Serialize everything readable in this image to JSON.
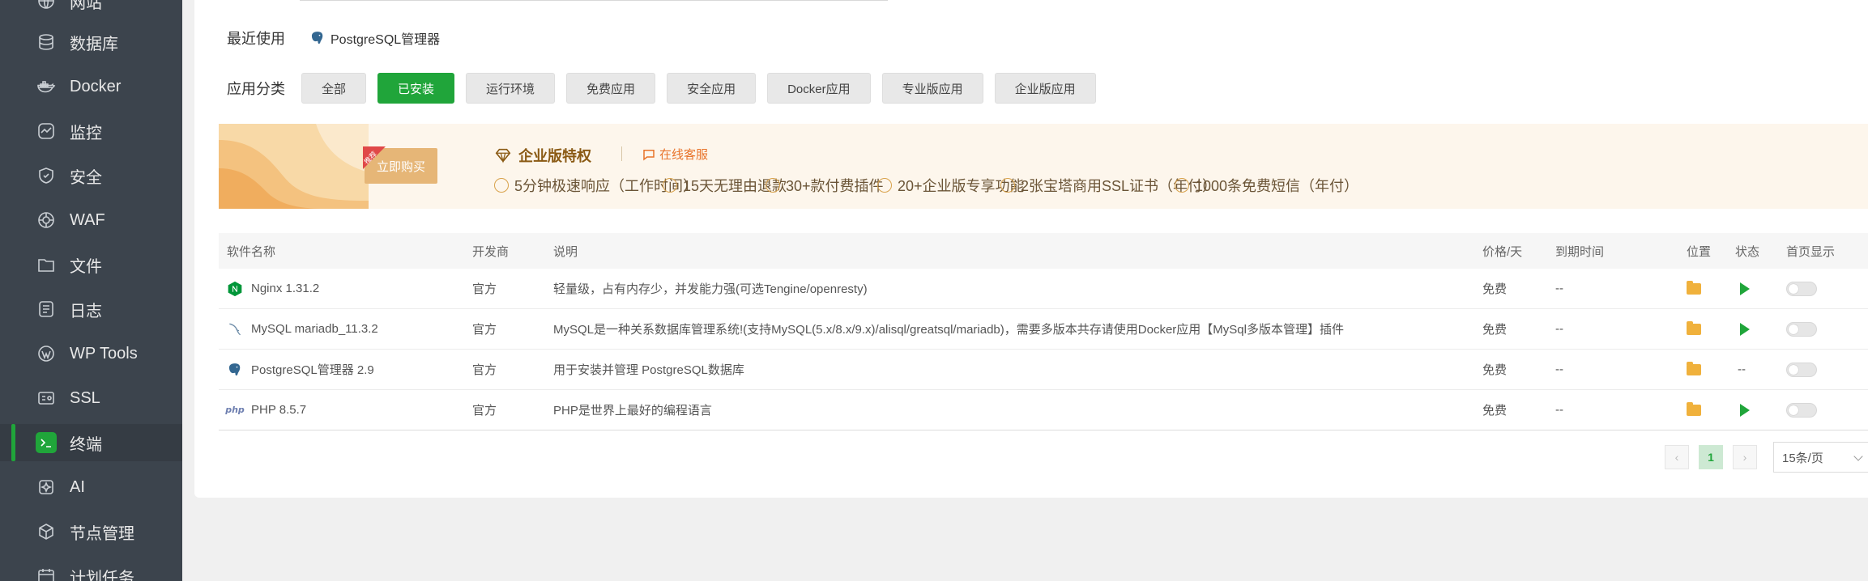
{
  "sidebar": {
    "items": [
      {
        "label": "网站",
        "icon": "globe-icon"
      },
      {
        "label": "数据库",
        "icon": "database-icon"
      },
      {
        "label": "Docker",
        "icon": "docker-icon"
      },
      {
        "label": "监控",
        "icon": "monitor-icon"
      },
      {
        "label": "安全",
        "icon": "shield-icon"
      },
      {
        "label": "WAF",
        "icon": "waf-icon"
      },
      {
        "label": "文件",
        "icon": "folder-icon"
      },
      {
        "label": "日志",
        "icon": "log-icon"
      },
      {
        "label": "WP Tools",
        "icon": "wordpress-icon"
      },
      {
        "label": "SSL",
        "icon": "ssl-icon"
      },
      {
        "label": "终端",
        "icon": "terminal-icon"
      },
      {
        "label": "AI",
        "icon": "ai-icon"
      },
      {
        "label": "节点管理",
        "icon": "node-icon"
      },
      {
        "label": "计划任务",
        "icon": "calendar-icon"
      }
    ],
    "active_label": "终端"
  },
  "recent": {
    "label": "最近使用",
    "app": "PostgreSQL管理器"
  },
  "categories": {
    "label": "应用分类",
    "items": [
      "全部",
      "已安装",
      "运行环境",
      "免费应用",
      "安全应用",
      "Docker应用",
      "专业版应用",
      "企业版应用"
    ],
    "active": "已安装"
  },
  "banner": {
    "buy_tag": "推荐",
    "buy_label": "立即购买",
    "title": "企业版特权",
    "service": "在线客服",
    "features": [
      "5分钟极速响应（工作时间）",
      "15天无理由退款",
      "30+款付费插件",
      "20+企业版专享功能",
      "2张宝塔商用SSL证书（年付）",
      "1000条免费短信（年付）"
    ],
    "accent": "#8a5a14"
  },
  "table": {
    "headers": {
      "name": "软件名称",
      "dev": "开发商",
      "desc": "说明",
      "price": "价格/天",
      "expire": "到期时间",
      "loc": "位置",
      "status": "状态",
      "home": "首页显示"
    },
    "rows": [
      {
        "name": "Nginx 1.31.2",
        "icon": "nginx-icon",
        "dev": "官方",
        "desc": "轻量级，占有内存少，并发能力强(可选Tengine/openresty)",
        "price": "免费",
        "expire": "--",
        "status": "play"
      },
      {
        "name": "MySQL mariadb_11.3.2",
        "icon": "mysql-icon",
        "dev": "官方",
        "desc": "MySQL是一种关系数据库管理系统!(支持MySQL(5.x/8.x/9.x)/alisql/greatsql/mariadb)，需要多版本共存请使用Docker应用【MySql多版本管理】插件",
        "price": "免费",
        "expire": "--",
        "status": "play"
      },
      {
        "name": "PostgreSQL管理器 2.9",
        "icon": "postgresql-icon",
        "dev": "官方",
        "desc": "用于安装并管理 PostgreSQL数据库",
        "price": "免费",
        "expire": "--",
        "status": "--"
      },
      {
        "name": "PHP 8.5.7",
        "icon": "php-icon",
        "dev": "官方",
        "desc": "PHP是世界上最好的编程语言",
        "price": "免费",
        "expire": "--",
        "status": "play"
      }
    ]
  },
  "pager": {
    "prev": "‹",
    "current": "1",
    "next": "›",
    "page_size": "15条/页"
  },
  "colors": {
    "brand": "#20a53a",
    "sidebar_bg": "#3c444d"
  }
}
